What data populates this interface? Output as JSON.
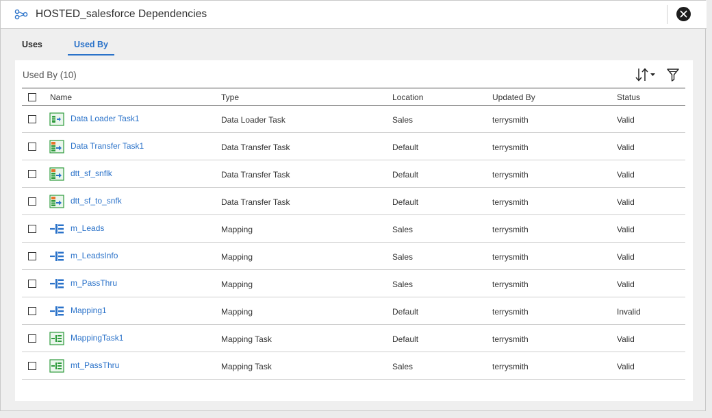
{
  "dialog": {
    "title": "HOSTED_salesforce Dependencies",
    "title_icon": "dependency-icon",
    "close_icon": "close-icon"
  },
  "tabs": [
    {
      "label": "Uses",
      "active": false
    },
    {
      "label": "Used By",
      "active": true
    }
  ],
  "panel": {
    "title": "Used By (10)",
    "sort_icon": "sort-icon",
    "filter_icon": "filter-icon"
  },
  "table": {
    "headers": {
      "name": "Name",
      "type": "Type",
      "location": "Location",
      "updated_by": "Updated By",
      "status": "Status"
    },
    "rows": [
      {
        "icon": "data-loader-task-icon",
        "name": "Data Loader Task1",
        "type": "Data Loader Task",
        "location": "Sales",
        "updated_by": "terrysmith",
        "status": "Valid"
      },
      {
        "icon": "data-transfer-task-icon",
        "name": "Data Transfer Task1",
        "type": "Data Transfer Task",
        "location": "Default",
        "updated_by": "terrysmith",
        "status": "Valid"
      },
      {
        "icon": "data-transfer-task-icon",
        "name": "dtt_sf_snflk",
        "type": "Data Transfer Task",
        "location": "Default",
        "updated_by": "terrysmith",
        "status": "Valid"
      },
      {
        "icon": "data-transfer-task-icon",
        "name": "dtt_sf_to_snfk",
        "type": "Data Transfer Task",
        "location": "Default",
        "updated_by": "terrysmith",
        "status": "Valid"
      },
      {
        "icon": "mapping-icon",
        "name": "m_Leads",
        "type": "Mapping",
        "location": "Sales",
        "updated_by": "terrysmith",
        "status": "Valid"
      },
      {
        "icon": "mapping-icon",
        "name": "m_LeadsInfo",
        "type": "Mapping",
        "location": "Sales",
        "updated_by": "terrysmith",
        "status": "Valid"
      },
      {
        "icon": "mapping-icon",
        "name": "m_PassThru",
        "type": "Mapping",
        "location": "Sales",
        "updated_by": "terrysmith",
        "status": "Valid"
      },
      {
        "icon": "mapping-icon",
        "name": "Mapping1",
        "type": "Mapping",
        "location": "Default",
        "updated_by": "terrysmith",
        "status": "Invalid"
      },
      {
        "icon": "mapping-task-icon",
        "name": "MappingTask1",
        "type": "Mapping Task",
        "location": "Default",
        "updated_by": "terrysmith",
        "status": "Valid"
      },
      {
        "icon": "mapping-task-icon",
        "name": "mt_PassThru",
        "type": "Mapping Task",
        "location": "Sales",
        "updated_by": "terrysmith",
        "status": "Valid"
      }
    ]
  },
  "colors": {
    "link": "#2a72c9",
    "active_tab": "#2a72c9",
    "icon_green": "#2e9b3c",
    "icon_blue": "#2a72c9",
    "icon_orange": "#e8742a"
  }
}
